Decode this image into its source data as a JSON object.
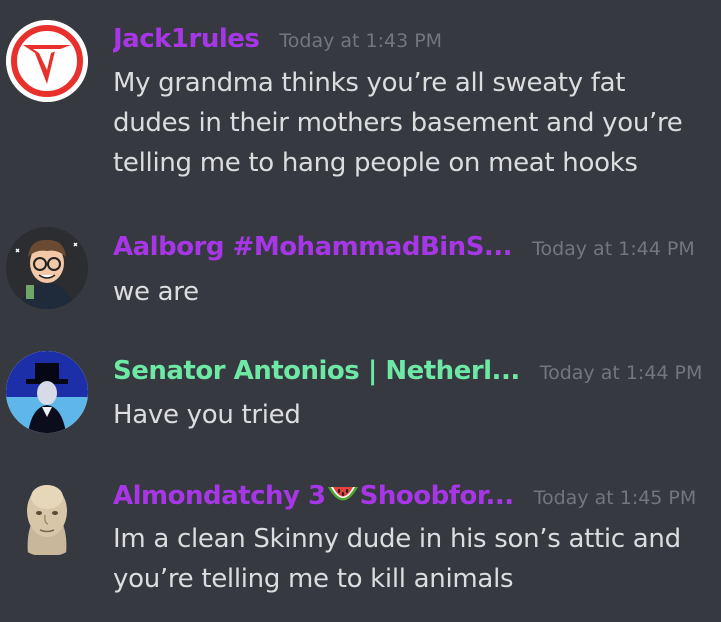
{
  "messages": [
    {
      "username": "Jack1rules",
      "username_color": "#a737e6",
      "timestamp": "Today at 1:43 PM",
      "content": "My grandma thinks you’re all sweaty fat dudes in their mothers basement and you’re telling me to hang people on meat hooks",
      "avatar_icon": "red-v-logo-icon"
    },
    {
      "username": "Aalborg #MohammadBinS...",
      "username_color": "#a737e6",
      "timestamp": "Today at 1:44 PM",
      "content": "we are",
      "avatar_icon": "cartoon-glasses-man-icon"
    },
    {
      "username": "Senator Antonios | Netherl...",
      "username_color": "#6ee8a5",
      "timestamp": "Today at 1:44 PM",
      "content": "Have you tried",
      "avatar_icon": "man-in-hat-photo-icon"
    },
    {
      "username_prefix": "Almondatchy 3",
      "username_suffix": "Shoobfor...",
      "username_emoji": "watermelon-icon",
      "username_color": "#a737e6",
      "timestamp": "Today at 1:45 PM",
      "content": "Im a clean Skinny dude in his son’s attic and you’re telling me to kill animals",
      "avatar_icon": "meme-man-face-icon"
    }
  ]
}
